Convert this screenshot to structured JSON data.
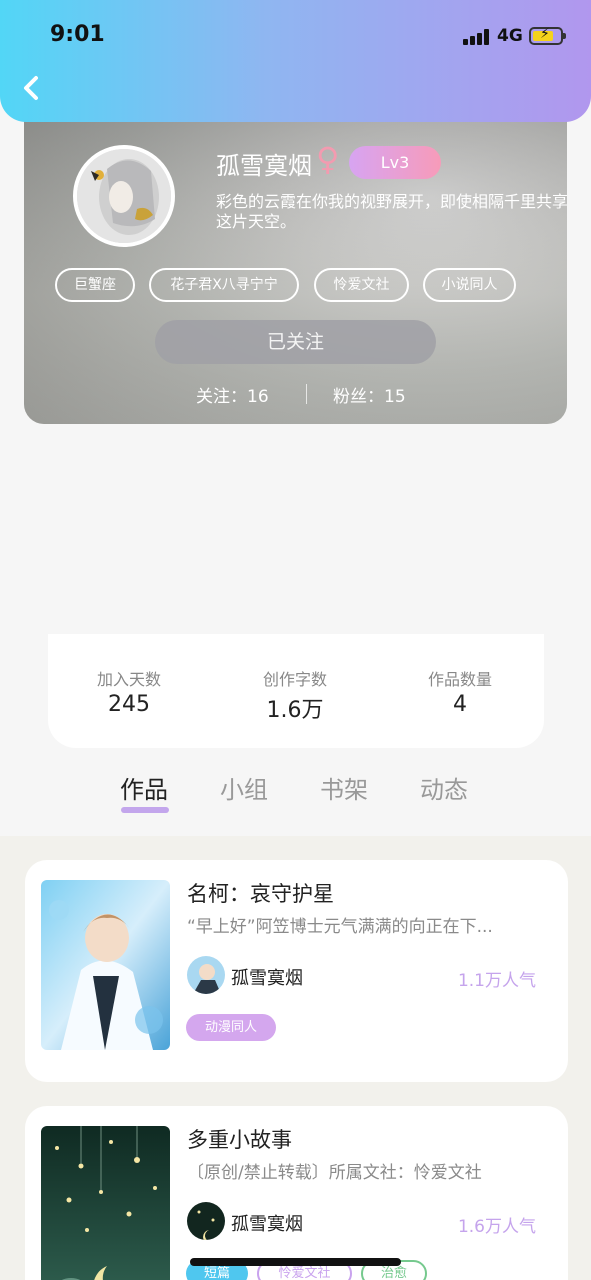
{
  "status_bar": {
    "time": "9:01",
    "network": "4G"
  },
  "profile": {
    "nickname": "孤雪寞烟",
    "gender_icon": "female-symbol-icon",
    "level": "Lv3",
    "bio": "彩色的云霞在你我的视野展开，即使相隔千里共享这片天空。",
    "tags": [
      "巨蟹座",
      "花子君X八寻宁宁",
      "怜爱文社",
      "小说同人"
    ],
    "follow_button": "已关注",
    "following_label": "关注：",
    "following_count": "16",
    "followers_label": "粉丝：",
    "followers_count": "15"
  },
  "stats": [
    {
      "label": "加入天数",
      "value": "245"
    },
    {
      "label": "创作字数",
      "value": "1.6万"
    },
    {
      "label": "作品数量",
      "value": "4"
    }
  ],
  "tabs": [
    "作品",
    "小组",
    "书架",
    "动态"
  ],
  "works": [
    {
      "title": "名柯：哀守护星",
      "summary": "“早上好”阿笠博士元气满满的向正在下...",
      "author": "孤雪寞烟",
      "popularity": "1.1万人气",
      "tags": [
        "动漫同人"
      ]
    },
    {
      "title": "多重小故事",
      "summary": "〔原创/禁止转载〕所属文社：怜爱文社",
      "author": "孤雪寞烟",
      "popularity": "1.6万人气",
      "tags": [
        "短篇",
        "怜爱文社",
        "治愈"
      ]
    }
  ],
  "colors": {
    "accent": "#c3a6ec",
    "header_start": "#52d6f6",
    "header_end": "#b197ee"
  }
}
